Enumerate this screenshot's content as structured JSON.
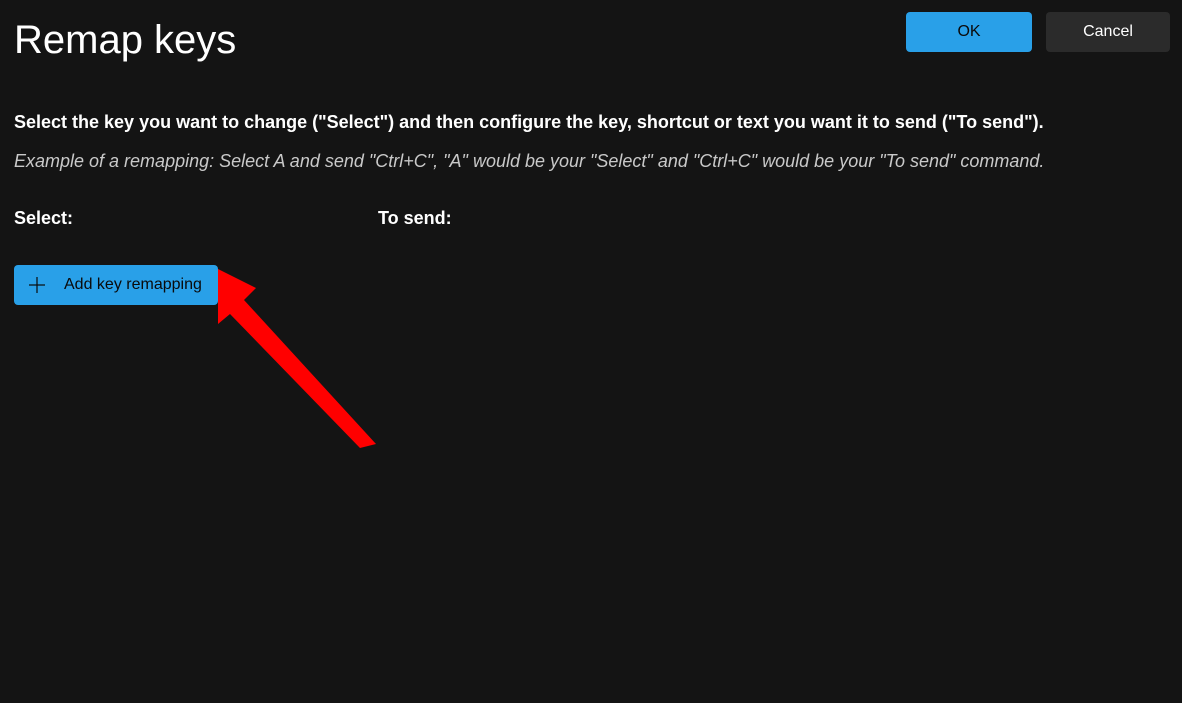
{
  "dialog": {
    "title": "Remap keys",
    "ok_label": "OK",
    "cancel_label": "Cancel",
    "description": "Select the key you want to change (\"Select\") and then configure the key, shortcut or text you want it to send (\"To send\").",
    "example": "Example of a remapping: Select A and send \"Ctrl+C\", \"A\" would be your \"Select\" and \"Ctrl+C\" would be your \"To send\" command.",
    "columns": {
      "select_label": "Select:",
      "to_send_label": "To send:"
    },
    "add_button_label": "Add key remapping"
  },
  "colors": {
    "accent": "#29a0e8",
    "background": "#141414",
    "secondary_button": "#2b2b2b",
    "annotation": "#ff0000"
  }
}
